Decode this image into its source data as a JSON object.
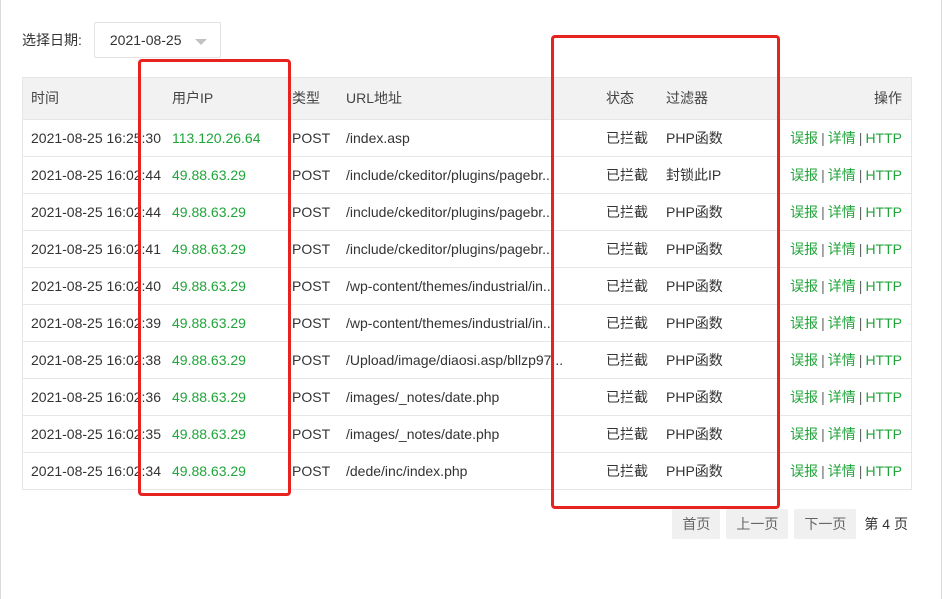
{
  "date_filter": {
    "label": "选择日期:",
    "value": "2021-08-25"
  },
  "table": {
    "headers": {
      "time": "时间",
      "ip": "用户IP",
      "type": "类型",
      "url": "URL地址",
      "status": "状态",
      "filter": "过滤器",
      "action": "操作"
    },
    "action_labels": {
      "report": "误报",
      "detail": "详情",
      "http": "HTTP",
      "separator": "|"
    },
    "rows": [
      {
        "time": "2021-08-25 16:25:30",
        "ip": "113.120.26.64",
        "type": "POST",
        "url": "/index.asp",
        "status": "已拦截",
        "filter": "PHP函数"
      },
      {
        "time": "2021-08-25 16:02:44",
        "ip": "49.88.63.29",
        "type": "POST",
        "url": "/include/ckeditor/plugins/pagebr...",
        "status": "已拦截",
        "filter": "封锁此IP"
      },
      {
        "time": "2021-08-25 16:02:44",
        "ip": "49.88.63.29",
        "type": "POST",
        "url": "/include/ckeditor/plugins/pagebr...",
        "status": "已拦截",
        "filter": "PHP函数"
      },
      {
        "time": "2021-08-25 16:02:41",
        "ip": "49.88.63.29",
        "type": "POST",
        "url": "/include/ckeditor/plugins/pagebr...",
        "status": "已拦截",
        "filter": "PHP函数"
      },
      {
        "time": "2021-08-25 16:02:40",
        "ip": "49.88.63.29",
        "type": "POST",
        "url": "/wp-content/themes/industrial/in...",
        "status": "已拦截",
        "filter": "PHP函数"
      },
      {
        "time": "2021-08-25 16:02:39",
        "ip": "49.88.63.29",
        "type": "POST",
        "url": "/wp-content/themes/industrial/in...",
        "status": "已拦截",
        "filter": "PHP函数"
      },
      {
        "time": "2021-08-25 16:02:38",
        "ip": "49.88.63.29",
        "type": "POST",
        "url": "/Upload/image/diaosi.asp/bllzp97...",
        "status": "已拦截",
        "filter": "PHP函数"
      },
      {
        "time": "2021-08-25 16:02:36",
        "ip": "49.88.63.29",
        "type": "POST",
        "url": "/images/_notes/date.php",
        "status": "已拦截",
        "filter": "PHP函数"
      },
      {
        "time": "2021-08-25 16:02:35",
        "ip": "49.88.63.29",
        "type": "POST",
        "url": "/images/_notes/date.php",
        "status": "已拦截",
        "filter": "PHP函数"
      },
      {
        "time": "2021-08-25 16:02:34",
        "ip": "49.88.63.29",
        "type": "POST",
        "url": "/dede/inc/index.php",
        "status": "已拦截",
        "filter": "PHP函数"
      }
    ]
  },
  "pagination": {
    "first": "首页",
    "prev": "上一页",
    "next": "下一页",
    "current": "第 4 页"
  },
  "colors": {
    "ip_green": "#20a53a",
    "link_green": "#20a53a",
    "highlight_red": "#e8231f",
    "header_bg": "#f2f2f2"
  }
}
